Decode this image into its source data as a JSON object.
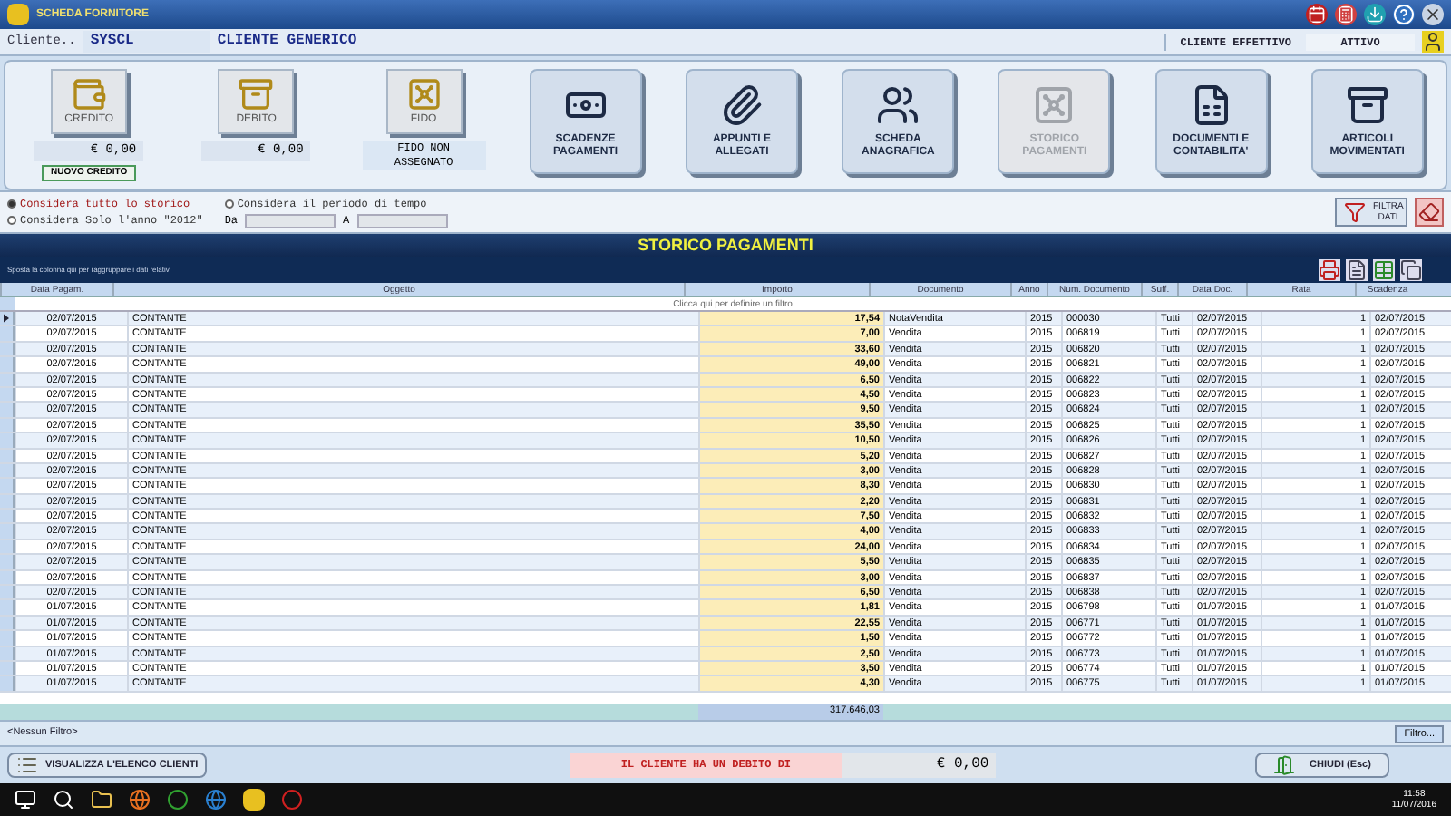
{
  "window": {
    "title": "SCHEDA FORNITORE"
  },
  "client": {
    "label": "Cliente..",
    "code": "SYSCL",
    "name": "CLIENTE GENERICO",
    "type": "CLIENTE EFFETTIVO",
    "status": "ATTIVO"
  },
  "toolbar": [
    {
      "kind": "amount",
      "label": "CREDITO",
      "value": "€ 0,00",
      "action": "NUOVO CREDITO"
    },
    {
      "kind": "amount",
      "label": "DEBITO",
      "value": "€ 0,00"
    },
    {
      "kind": "note",
      "label": "FIDO",
      "note": "FIDO NON ASSEGNATO"
    },
    {
      "kind": "tile",
      "label": "SCADENZE PAGAMENTI",
      "selected": false
    },
    {
      "kind": "tile",
      "label": "APPUNTI E ALLEGATI",
      "selected": false
    },
    {
      "kind": "tile",
      "label": "SCHEDA ANAGRAFICA",
      "selected": false
    },
    {
      "kind": "tile",
      "label": "STORICO PAGAMENTI",
      "selected": true
    },
    {
      "kind": "tile",
      "label": "DOCUMENTI E CONTABILITA'",
      "selected": false
    },
    {
      "kind": "tile",
      "label": "ARTICOLI MOVIMENTATI",
      "selected": false
    }
  ],
  "options": [
    {
      "label": "Considera tutto lo storico",
      "selected": true
    },
    {
      "label": "Considera il periodo di tempo",
      "selected": false
    },
    {
      "label": "Considera Solo l'anno \"2012\"",
      "selected": false
    }
  ],
  "period": {
    "from_label": "Da",
    "to_label": "A"
  },
  "filter_button": "FILTRA DATI",
  "grid": {
    "title": "STORICO PAGAMENTI",
    "group_hint": "Sposta la colonna qui per raggruppare i dati relativi",
    "filter_hint": "Clicca qui per definire un filtro",
    "columns": [
      "Data Pagam.",
      "Oggetto",
      "Importo",
      "Documento",
      "Anno",
      "Num. Documento",
      "Suff.",
      "Data Doc.",
      "Rata",
      "Scadenza"
    ],
    "rows": [
      {
        "selected": true,
        "cells": [
          "02/07/2015",
          "CONTANTE",
          "17,54",
          "NotaVendita",
          "2015",
          "000030",
          "Tutti",
          "02/07/2015",
          "1",
          "02/07/2015"
        ]
      },
      {
        "selected": false,
        "cells": [
          "02/07/2015",
          "CONTANTE",
          "7,00",
          "Vendita",
          "2015",
          "006819",
          "Tutti",
          "02/07/2015",
          "1",
          "02/07/2015"
        ]
      },
      {
        "selected": false,
        "cells": [
          "02/07/2015",
          "CONTANTE",
          "33,60",
          "Vendita",
          "2015",
          "006820",
          "Tutti",
          "02/07/2015",
          "1",
          "02/07/2015"
        ]
      },
      {
        "selected": false,
        "cells": [
          "02/07/2015",
          "CONTANTE",
          "49,00",
          "Vendita",
          "2015",
          "006821",
          "Tutti",
          "02/07/2015",
          "1",
          "02/07/2015"
        ]
      },
      {
        "selected": false,
        "cells": [
          "02/07/2015",
          "CONTANTE",
          "6,50",
          "Vendita",
          "2015",
          "006822",
          "Tutti",
          "02/07/2015",
          "1",
          "02/07/2015"
        ]
      },
      {
        "selected": false,
        "cells": [
          "02/07/2015",
          "CONTANTE",
          "4,50",
          "Vendita",
          "2015",
          "006823",
          "Tutti",
          "02/07/2015",
          "1",
          "02/07/2015"
        ]
      },
      {
        "selected": false,
        "cells": [
          "02/07/2015",
          "CONTANTE",
          "9,50",
          "Vendita",
          "2015",
          "006824",
          "Tutti",
          "02/07/2015",
          "1",
          "02/07/2015"
        ]
      },
      {
        "selected": false,
        "cells": [
          "02/07/2015",
          "CONTANTE",
          "35,50",
          "Vendita",
          "2015",
          "006825",
          "Tutti",
          "02/07/2015",
          "1",
          "02/07/2015"
        ]
      },
      {
        "selected": false,
        "cells": [
          "02/07/2015",
          "CONTANTE",
          "10,50",
          "Vendita",
          "2015",
          "006826",
          "Tutti",
          "02/07/2015",
          "1",
          "02/07/2015"
        ]
      },
      {
        "selected": false,
        "cells": [
          "02/07/2015",
          "CONTANTE",
          "5,20",
          "Vendita",
          "2015",
          "006827",
          "Tutti",
          "02/07/2015",
          "1",
          "02/07/2015"
        ]
      },
      {
        "selected": false,
        "cells": [
          "02/07/2015",
          "CONTANTE",
          "3,00",
          "Vendita",
          "2015",
          "006828",
          "Tutti",
          "02/07/2015",
          "1",
          "02/07/2015"
        ]
      },
      {
        "selected": false,
        "cells": [
          "02/07/2015",
          "CONTANTE",
          "8,30",
          "Vendita",
          "2015",
          "006830",
          "Tutti",
          "02/07/2015",
          "1",
          "02/07/2015"
        ]
      },
      {
        "selected": false,
        "cells": [
          "02/07/2015",
          "CONTANTE",
          "2,20",
          "Vendita",
          "2015",
          "006831",
          "Tutti",
          "02/07/2015",
          "1",
          "02/07/2015"
        ]
      },
      {
        "selected": false,
        "cells": [
          "02/07/2015",
          "CONTANTE",
          "7,50",
          "Vendita",
          "2015",
          "006832",
          "Tutti",
          "02/07/2015",
          "1",
          "02/07/2015"
        ]
      },
      {
        "selected": false,
        "cells": [
          "02/07/2015",
          "CONTANTE",
          "4,00",
          "Vendita",
          "2015",
          "006833",
          "Tutti",
          "02/07/2015",
          "1",
          "02/07/2015"
        ]
      },
      {
        "selected": false,
        "cells": [
          "02/07/2015",
          "CONTANTE",
          "24,00",
          "Vendita",
          "2015",
          "006834",
          "Tutti",
          "02/07/2015",
          "1",
          "02/07/2015"
        ]
      },
      {
        "selected": false,
        "cells": [
          "02/07/2015",
          "CONTANTE",
          "5,50",
          "Vendita",
          "2015",
          "006835",
          "Tutti",
          "02/07/2015",
          "1",
          "02/07/2015"
        ]
      },
      {
        "selected": false,
        "cells": [
          "02/07/2015",
          "CONTANTE",
          "3,00",
          "Vendita",
          "2015",
          "006837",
          "Tutti",
          "02/07/2015",
          "1",
          "02/07/2015"
        ]
      },
      {
        "selected": false,
        "cells": [
          "02/07/2015",
          "CONTANTE",
          "6,50",
          "Vendita",
          "2015",
          "006838",
          "Tutti",
          "02/07/2015",
          "1",
          "02/07/2015"
        ]
      },
      {
        "selected": false,
        "cells": [
          "01/07/2015",
          "CONTANTE",
          "1,81",
          "Vendita",
          "2015",
          "006798",
          "Tutti",
          "01/07/2015",
          "1",
          "01/07/2015"
        ]
      },
      {
        "selected": false,
        "cells": [
          "01/07/2015",
          "CONTANTE",
          "22,55",
          "Vendita",
          "2015",
          "006771",
          "Tutti",
          "01/07/2015",
          "1",
          "01/07/2015"
        ]
      },
      {
        "selected": false,
        "cells": [
          "01/07/2015",
          "CONTANTE",
          "1,50",
          "Vendita",
          "2015",
          "006772",
          "Tutti",
          "01/07/2015",
          "1",
          "01/07/2015"
        ]
      },
      {
        "selected": false,
        "cells": [
          "01/07/2015",
          "CONTANTE",
          "2,50",
          "Vendita",
          "2015",
          "006773",
          "Tutti",
          "01/07/2015",
          "1",
          "01/07/2015"
        ]
      },
      {
        "selected": false,
        "cells": [
          "01/07/2015",
          "CONTANTE",
          "3,50",
          "Vendita",
          "2015",
          "006774",
          "Tutti",
          "01/07/2015",
          "1",
          "01/07/2015"
        ]
      },
      {
        "selected": false,
        "cells": [
          "01/07/2015",
          "CONTANTE",
          "4,30",
          "Vendita",
          "2015",
          "006775",
          "Tutti",
          "01/07/2015",
          "1",
          "01/07/2015"
        ]
      }
    ],
    "total": "317.646,03",
    "filter_status": "<Nessun Filtro>",
    "filter_button": "Filtro..."
  },
  "footer": {
    "list_button": "VISUALIZZA L'ELENCO CLIENTI",
    "debt_label": "IL CLIENTE HA UN DEBITO DI",
    "debt_value": "€ 0,00",
    "close_button": "CHIUDI (Esc)"
  },
  "taskbar": {
    "time": "11:58",
    "date": "11/07/2016"
  }
}
